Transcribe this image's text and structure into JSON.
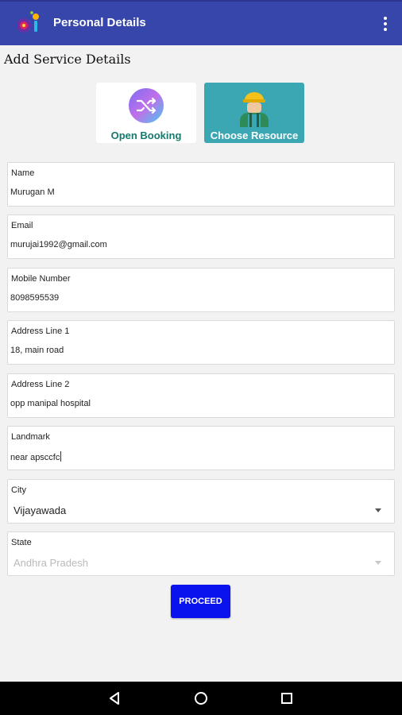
{
  "app_bar": {
    "title": "Personal Details",
    "logo_icon": "app-logo-icon",
    "menu_icon": "overflow-menu-icon",
    "color": "#3646ab"
  },
  "section_title": "Add Service Details",
  "options": [
    {
      "label": "Open Booking",
      "icon": "shuffle-icon",
      "selected": false
    },
    {
      "label": "Choose Resource",
      "icon": "worker-icon",
      "selected": true,
      "color": "#3aa7b2"
    }
  ],
  "form": {
    "name": {
      "label": "Name",
      "value": "Murugan M"
    },
    "email": {
      "label": "Email",
      "value": "murujai1992@gmail.com"
    },
    "mobile": {
      "label": "Mobile Number",
      "value": "8098595539"
    },
    "address1": {
      "label": "Address Line 1",
      "value": "18, main road"
    },
    "address2": {
      "label": "Address Line 2",
      "value": "opp manipal hospital"
    },
    "landmark": {
      "label": "Landmark",
      "value": "near apsccfc"
    },
    "city": {
      "label": "City",
      "value": "Vijayawada"
    },
    "state": {
      "label": "State",
      "value": "Andhra Pradesh",
      "disabled": true
    }
  },
  "proceed_label": "PROCEED",
  "proceed_color": "#0a12ee",
  "nav": {
    "back_icon": "back-icon",
    "home_icon": "home-icon",
    "recents_icon": "recents-icon"
  }
}
